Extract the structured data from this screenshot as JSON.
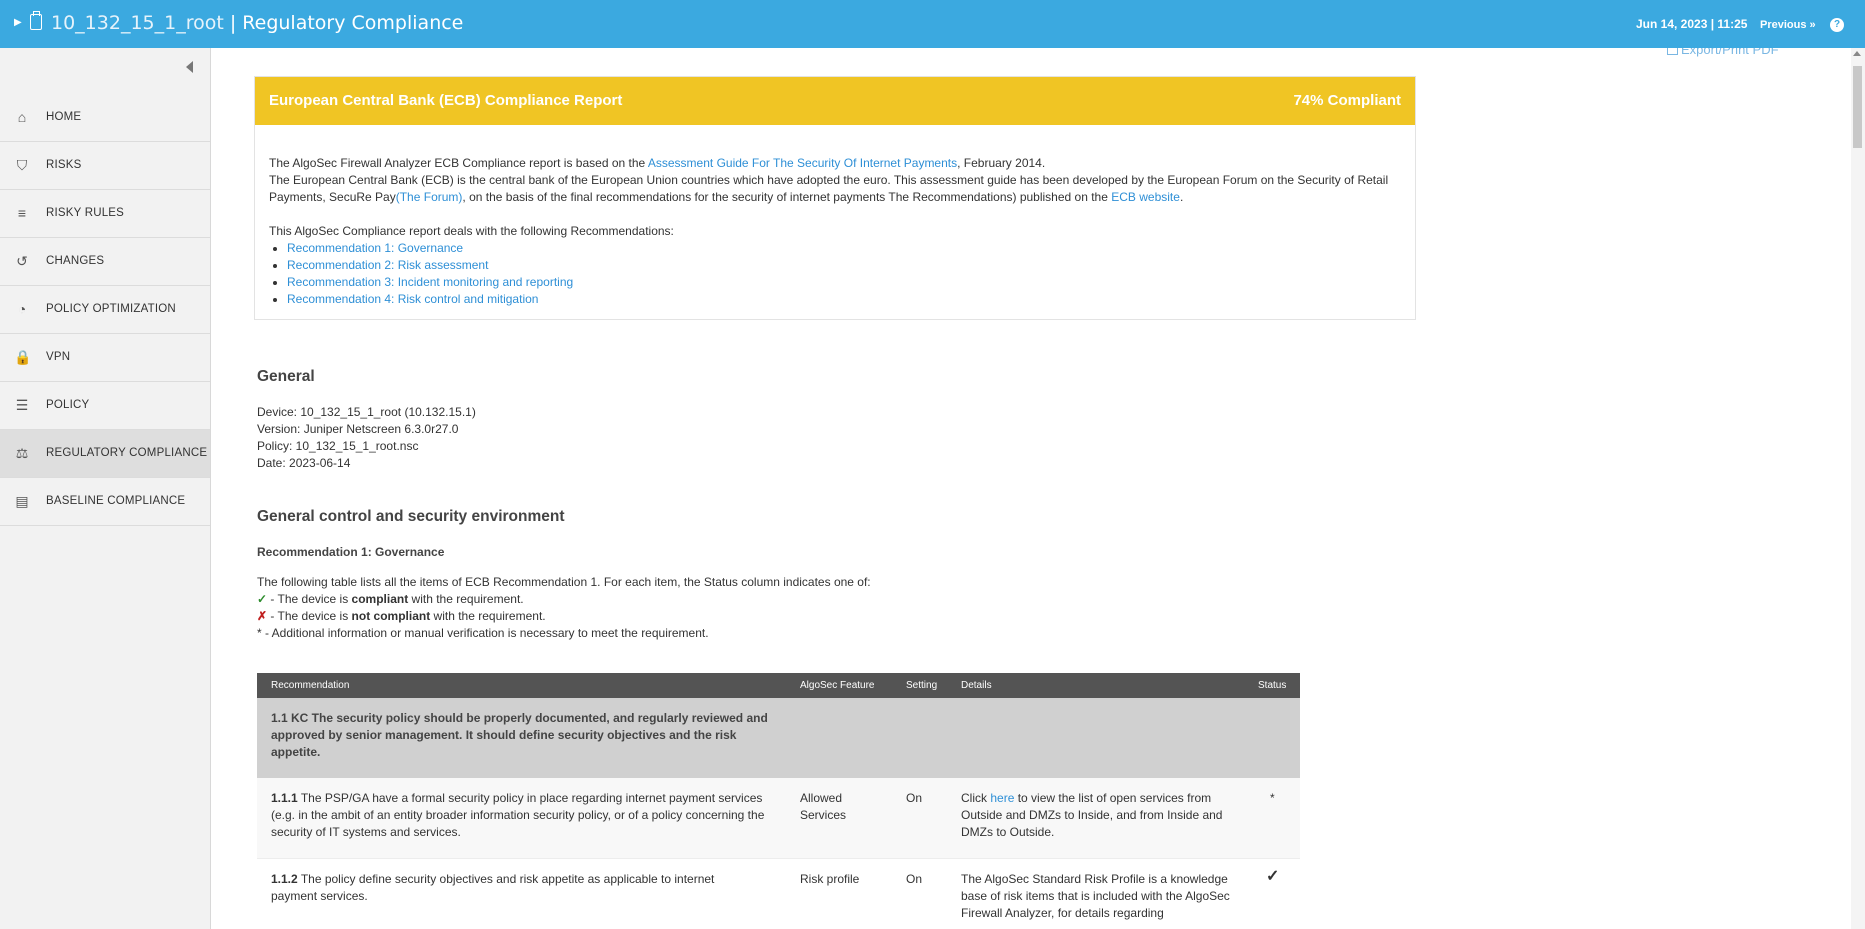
{
  "header": {
    "device": "10_132_15_1_root",
    "separator": " | ",
    "app_title": "Regulatory Compliance",
    "datetime": "Jun 14, 2023 | 11:25",
    "previous": "Previous »",
    "help": "?"
  },
  "sidebar": {
    "items": [
      {
        "label": "HOME",
        "icon": "home-icon",
        "glyph": "⌂"
      },
      {
        "label": "RISKS",
        "icon": "shield-icon",
        "glyph": "⛉"
      },
      {
        "label": "RISKY RULES",
        "icon": "risky-rules-icon",
        "glyph": "≡"
      },
      {
        "label": "CHANGES",
        "icon": "history-icon",
        "glyph": "↺"
      },
      {
        "label": "POLICY OPTIMIZATION",
        "icon": "gauge-icon",
        "glyph": "◔"
      },
      {
        "label": "VPN",
        "icon": "lock-icon",
        "glyph": "🔒"
      },
      {
        "label": "POLICY",
        "icon": "list-icon",
        "glyph": "☰"
      },
      {
        "label": "REGULATORY COMPLIANCE",
        "icon": "stamp-icon",
        "glyph": "⚖"
      },
      {
        "label": "BASELINE COMPLIANCE",
        "icon": "checklist-icon",
        "glyph": "▤"
      }
    ],
    "active_index": 7
  },
  "export_label": "Export/Print PDF",
  "report": {
    "title": "European Central Bank (ECB) Compliance Report",
    "compliance": "74% Compliant",
    "intro1_pre": "The AlgoSec Firewall Analyzer ECB Compliance report is based on the ",
    "intro1_link": "Assessment Guide For The Security Of Internet Payments",
    "intro1_post": ", February 2014.",
    "intro2_pre": "The European Central Bank (ECB) is the central bank of the European Union countries which have adopted the euro. This assessment guide has been developed by the European Forum on the Security of Retail Payments, SecuRe Pay",
    "intro2_link": "(The Forum)",
    "intro2_mid": ", on the basis of the final recommendations for the security of internet payments The Recommendations) published on the ",
    "intro2_link2": "ECB website",
    "intro2_post": ".",
    "deals_with": "This AlgoSec Compliance report deals with the following Recommendations:",
    "recommendations": [
      "Recommendation 1: Governance",
      "Recommendation 2: Risk assessment",
      "Recommendation 3: Incident monitoring and reporting",
      "Recommendation 4: Risk control and mitigation"
    ]
  },
  "general": {
    "heading": "General",
    "device": "Device: 10_132_15_1_root (10.132.15.1)",
    "version": "Version: Juniper Netscreen 6.3.0r27.0",
    "policy": "Policy: 10_132_15_1_root.nsc",
    "date": "Date: 2023-06-14"
  },
  "control": {
    "heading": "General control and security environment",
    "subheading": "Recommendation 1: Governance",
    "intro": "The following table lists all the items of ECB Recommendation 1. For each item, the Status column indicates one of:",
    "legend": [
      {
        "mark": "✓",
        "pre": " - The device is ",
        "bold": "compliant",
        "post": " with the requirement."
      },
      {
        "mark": "✗",
        "pre": " - The device is ",
        "bold": "not compliant",
        "post": " with the requirement."
      },
      {
        "mark": "*",
        "pre": " - Additional information or manual verification is necessary to meet the requirement.",
        "bold": "",
        "post": ""
      }
    ]
  },
  "table": {
    "headers": [
      "Recommendation",
      "AlgoSec Feature",
      "Setting",
      "Details",
      "Status"
    ],
    "group": "1.1 KC The security policy should be properly documented, and regularly reviewed and approved by senior management. It should define security objectives and the risk appetite.",
    "rows": [
      {
        "num": "1.1.1",
        "text": " The PSP/GA have a formal security policy in place regarding internet payment services (e.g. in the ambit of an entity broader information security policy, or of a policy concerning the security of IT systems and services.",
        "feature": "Allowed Services",
        "setting": "On",
        "details_pre": "Click ",
        "details_link": "here",
        "details_post": " to view the list of open services from Outside and DMZs to Inside, and from Inside and DMZs to Outside.",
        "status": "*"
      },
      {
        "num": "1.1.2",
        "text": " The policy define security objectives and risk appetite as applicable to internet payment services.",
        "feature": "Risk profile",
        "setting": "On",
        "details_pre": "The AlgoSec Standard Risk Profile is a knowledge base of risk items that is included with the AlgoSec Firewall Analyzer, for details regarding",
        "details_link": "",
        "details_post": "",
        "status": "✓"
      }
    ]
  },
  "colors": {
    "topbar": "#3ba9e0",
    "report_header": "#f0c524",
    "link": "#2e8fd6",
    "table_header": "#545454"
  }
}
